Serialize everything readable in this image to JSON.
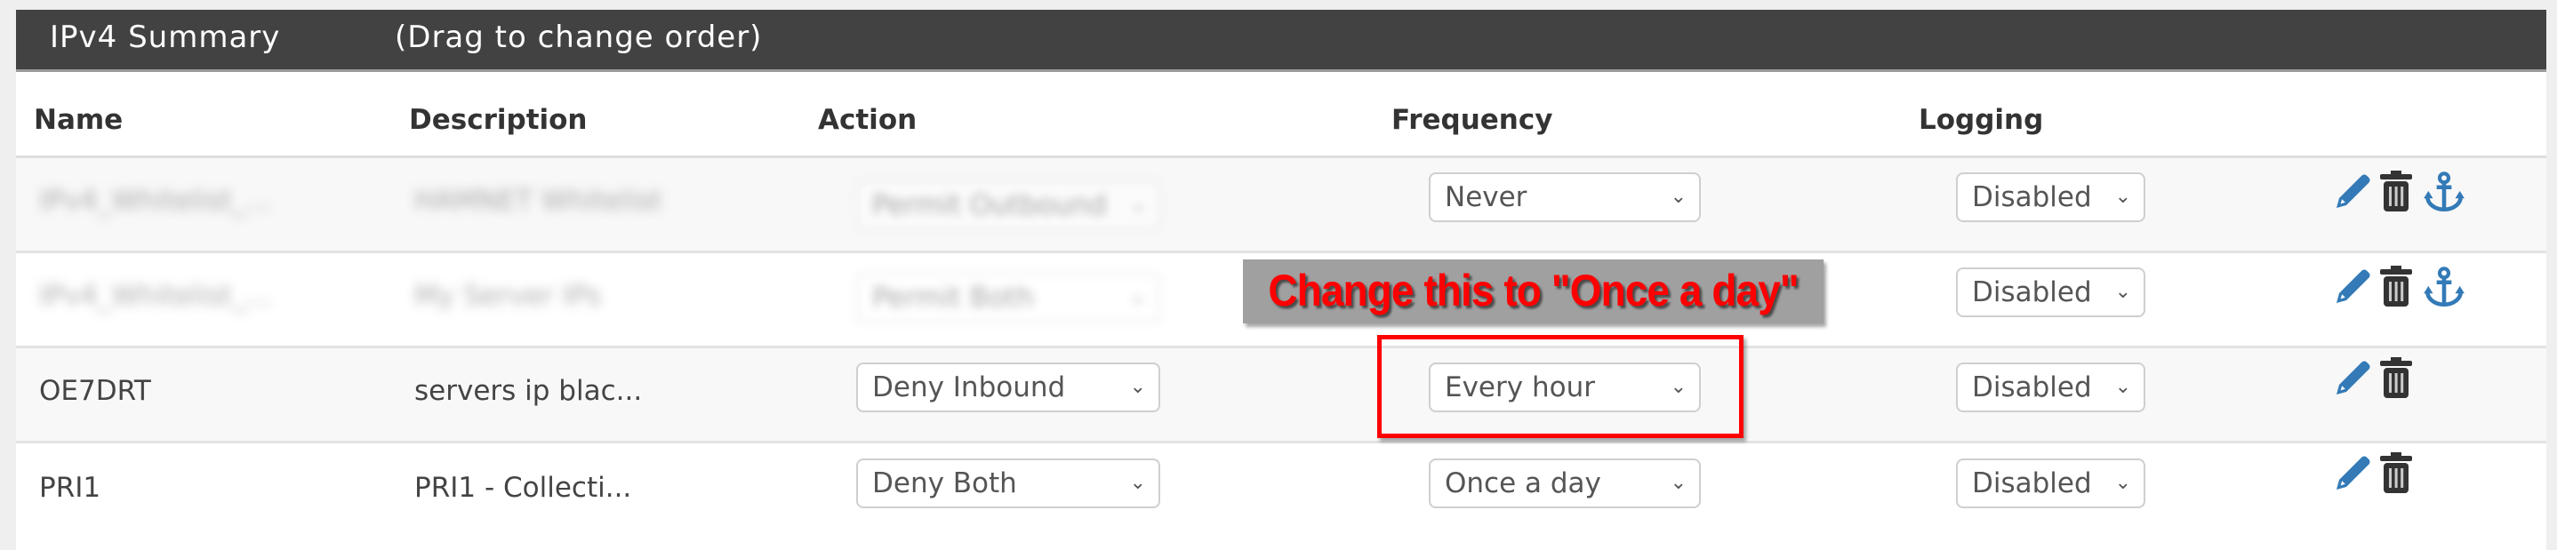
{
  "panel": {
    "title": "IPv4 Summary",
    "hint": "(Drag to change order)"
  },
  "columns": [
    "Name",
    "Description",
    "Action",
    "Frequency",
    "Logging",
    ""
  ],
  "rows": [
    {
      "name": "IPv4_Whitelist_...",
      "description": "HAMNET Whitelist",
      "action": "Permit Outbound",
      "frequency": "Never",
      "logging": "Disabled",
      "blurred": true,
      "icons": [
        "pencil-icon",
        "trash-icon",
        "anchor-icon"
      ]
    },
    {
      "name": "IPv4_Whitelist_...",
      "description": "My Server IPs",
      "action": "Permit Both",
      "frequency": "",
      "logging": "Disabled",
      "blurred": true,
      "icons": [
        "pencil-icon",
        "trash-icon",
        "anchor-icon"
      ]
    },
    {
      "name": "OE7DRT",
      "description": "servers ip blac...",
      "action": "Deny Inbound",
      "frequency": "Every hour",
      "logging": "Disabled",
      "blurred": false,
      "icons": [
        "pencil-icon",
        "trash-icon"
      ]
    },
    {
      "name": "PRI1",
      "description": "PRI1 - Collecti...",
      "action": "Deny Both",
      "frequency": "Once a day",
      "logging": "Disabled",
      "blurred": false,
      "icons": [
        "pencil-icon",
        "trash-icon"
      ]
    }
  ],
  "annotation": {
    "text": "Change this to \"Once a day\"",
    "text_color": "#ff0000",
    "box_color": "#a0a0a0",
    "highlight_color": "#ff0000"
  },
  "colors": {
    "header_bg": "#424242",
    "icon_blue": "#337ab7",
    "icon_dark": "#333333"
  },
  "chevron": "⌄"
}
